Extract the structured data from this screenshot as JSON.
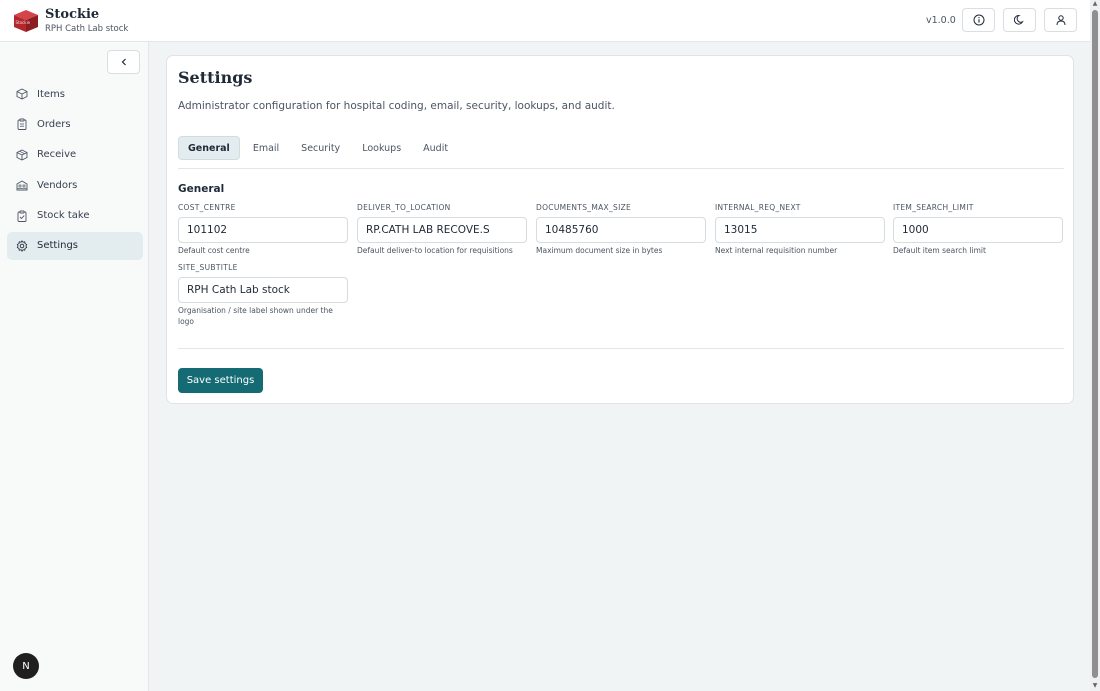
{
  "app": {
    "name": "Stockie",
    "site_label": "RPH Cath Lab stock",
    "version": "v1.0.0",
    "logo_text": "Stockie"
  },
  "header": {
    "info_icon": "info-icon",
    "theme_icon": "moon-icon",
    "user_icon": "user-icon"
  },
  "sidebar": {
    "collapse_icon": "chevron-left-icon",
    "items": [
      {
        "label": "Items",
        "icon": "box-icon"
      },
      {
        "label": "Orders",
        "icon": "clipboard-icon"
      },
      {
        "label": "Receive",
        "icon": "package-in-icon"
      },
      {
        "label": "Vendors",
        "icon": "building-icon"
      },
      {
        "label": "Stock take",
        "icon": "clipboard-check-icon"
      },
      {
        "label": "Settings",
        "icon": "gear-icon",
        "active": true
      }
    ],
    "avatar_letter": "N"
  },
  "page": {
    "title": "Settings",
    "description": "Administrator configuration for hospital coding, email, security, lookups, and audit.",
    "tabs": [
      "General",
      "Email",
      "Security",
      "Lookups",
      "Audit"
    ],
    "active_tab": "General",
    "section_title": "General",
    "fields": [
      {
        "label": "COST_CENTRE",
        "value": "101102",
        "help": "Default cost centre"
      },
      {
        "label": "DELIVER_TO_LOCATION",
        "value": "RP.CATH LAB RECOVE.S",
        "help": "Default deliver-to location for requisitions"
      },
      {
        "label": "DOCUMENTS_MAX_SIZE",
        "value": "10485760",
        "help": "Maximum document size in bytes"
      },
      {
        "label": "INTERNAL_REQ_NEXT",
        "value": "13015",
        "help": "Next internal requisition number"
      },
      {
        "label": "ITEM_SEARCH_LIMIT",
        "value": "1000",
        "help": "Default item search limit"
      },
      {
        "label": "SITE_SUBTITLE",
        "value": "RPH Cath Lab stock",
        "help": "Organisation / site label shown under the logo"
      }
    ],
    "save_label": "Save settings"
  },
  "colors": {
    "accent": "#156b74",
    "logo_red": "#b3262b",
    "active_nav_bg": "#e3ecef"
  }
}
